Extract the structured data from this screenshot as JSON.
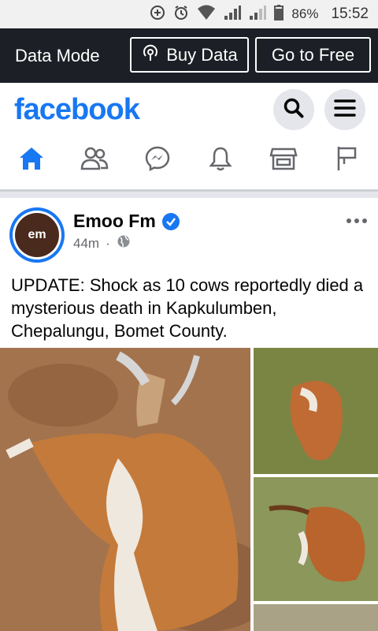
{
  "status_bar": {
    "battery": "86%",
    "time": "15:52"
  },
  "data_bar": {
    "mode_label": "Data Mode",
    "buy_data_label": "Buy Data",
    "go_free_label": "Go to Free"
  },
  "header": {
    "logo_text": "facebook",
    "brand_color": "#1877f2"
  },
  "nav": {
    "items": [
      {
        "name": "home",
        "icon": "home-icon",
        "active": true
      },
      {
        "name": "friends",
        "icon": "friends-icon"
      },
      {
        "name": "messenger",
        "icon": "messenger-icon"
      },
      {
        "name": "notifications",
        "icon": "bell-icon"
      },
      {
        "name": "marketplace",
        "icon": "store-icon"
      },
      {
        "name": "pages",
        "icon": "flag-icon"
      }
    ]
  },
  "post": {
    "author": "Emoo Fm",
    "avatar_text": "em",
    "time": "44m",
    "separator": "·",
    "text": "UPDATE: Shock as 10 cows reportedly died a mysterious death in Kapkulumben, Chepalungu, Bomet County."
  }
}
